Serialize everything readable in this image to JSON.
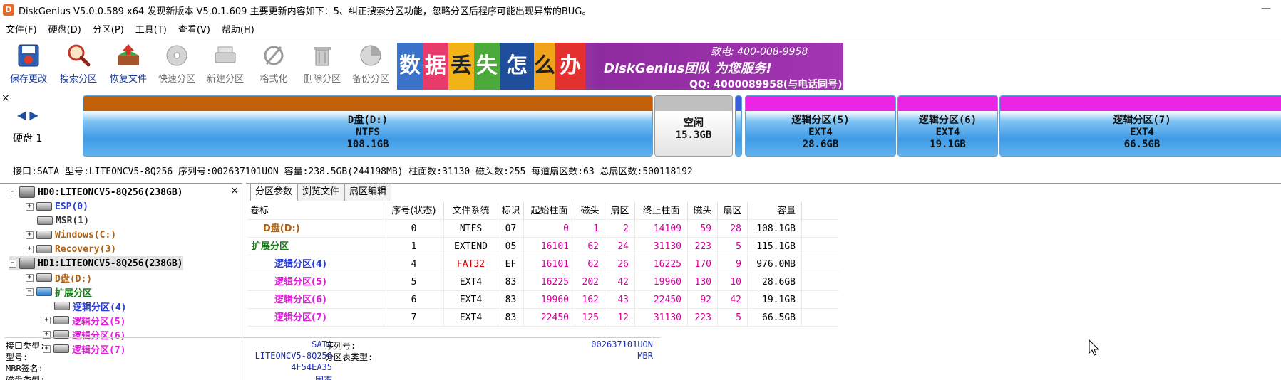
{
  "window": {
    "title": "DiskGenius V5.0.0.589 x64   发现新版本 V5.0.1.609 主要更新内容如下：5、纠正搜索分区功能，忽略分区后程序可能出现异常的BUG。",
    "app_icon": "D",
    "minimize_glyph": "—"
  },
  "menu": [
    "文件(F)",
    "硬盘(D)",
    "分区(P)",
    "工具(T)",
    "查看(V)",
    "帮助(H)"
  ],
  "toolbar": [
    {
      "label": "保存更改",
      "icon": "save-icon",
      "enabled": true
    },
    {
      "label": "搜索分区",
      "icon": "magnifier-icon",
      "enabled": true
    },
    {
      "label": "恢复文件",
      "icon": "recover-icon",
      "enabled": true
    },
    {
      "label": "快速分区",
      "icon": "quick-partition-icon",
      "enabled": false
    },
    {
      "label": "新建分区",
      "icon": "new-partition-icon",
      "enabled": false
    },
    {
      "label": "格式化",
      "icon": "format-icon",
      "enabled": false
    },
    {
      "label": "删除分区",
      "icon": "trash-icon",
      "enabled": false
    },
    {
      "label": "备份分区",
      "icon": "backup-icon",
      "enabled": false
    }
  ],
  "banner": {
    "tiles": [
      "数",
      "据",
      "丢",
      "失",
      "怎",
      "么",
      "办"
    ],
    "team_line": "DiskGenius团队 为您服务!",
    "phone_line": "致电: 400-008-9958",
    "qq_line": "QQ: 4000089958(与电话同号)",
    "colors": [
      "#3a73c9",
      "#e93a6c",
      "#f2b316",
      "#4caa3a",
      "#1f4f9c",
      "#f0a21a",
      "#e4312f"
    ]
  },
  "disk_bar": {
    "close_glyph": "×",
    "nav_glyphs": "◀ ▶",
    "disk_label": "硬盘 1",
    "partitions": [
      {
        "name": "D盘(D:)",
        "fs": "NTFS",
        "size": "108.1GB",
        "cap_color": "#c0600a"
      },
      {
        "name": "空闲",
        "fs": "",
        "size": "15.3GB",
        "cap_color": "#bfbfbf"
      },
      {
        "name": "逻辑分区(5)",
        "fs": "EXT4",
        "size": "28.6GB",
        "cap_color": "#ea25e4"
      },
      {
        "name": "逻辑分区(6)",
        "fs": "EXT4",
        "size": "19.1GB",
        "cap_color": "#ea25e4"
      },
      {
        "name": "逻辑分区(7)",
        "fs": "EXT4",
        "size": "66.5GB",
        "cap_color": "#ea25e4"
      }
    ],
    "info_line": "接口:SATA  型号:LITEONCV5-8Q256  序列号:002637101UON  容量:238.5GB(244198MB)  柱面数:31130  磁头数:255  每道扇区数:63  总扇区数:500118192"
  },
  "tree": {
    "close_glyph": "×",
    "items": [
      {
        "label": "HD0:LITEONCV5-8Q256(238GB)",
        "color": "#000000",
        "exp": "−",
        "kind": "disk"
      },
      {
        "label": "ESP(0)",
        "color": "#2a3fd8",
        "exp": "+",
        "kind": "part"
      },
      {
        "label": "MSR(1)",
        "color": "#333333",
        "exp": "",
        "kind": "part"
      },
      {
        "label": "Windows(C:)",
        "color": "#b06010",
        "exp": "+",
        "kind": "part"
      },
      {
        "label": "Recovery(3)",
        "color": "#b06010",
        "exp": "+",
        "kind": "part"
      },
      {
        "label": "HD1:LITEONCV5-8Q256(238GB)",
        "color": "#000000",
        "exp": "−",
        "kind": "disk"
      },
      {
        "label": "D盘(D:)",
        "color": "#b06010",
        "exp": "+",
        "kind": "part"
      },
      {
        "label": "扩展分区",
        "color": "#1a7a1a",
        "exp": "−",
        "kind": "ext"
      },
      {
        "label": "逻辑分区(4)",
        "color": "#2a3fd8",
        "exp": "",
        "kind": "part"
      },
      {
        "label": "逻辑分区(5)",
        "color": "#e020d8",
        "exp": "+",
        "kind": "part"
      },
      {
        "label": "逻辑分区(6)",
        "color": "#e020d8",
        "exp": "+",
        "kind": "part"
      },
      {
        "label": "逻辑分区(7)",
        "color": "#e020d8",
        "exp": "+",
        "kind": "part"
      }
    ]
  },
  "tabs": [
    "分区参数",
    "浏览文件",
    "扇区编辑"
  ],
  "table": {
    "headers": [
      "卷标",
      "序号(状态)",
      "文件系统",
      "标识",
      "起始柱面",
      "磁头",
      "扇区",
      "终止柱面",
      "磁头",
      "扇区",
      "容量"
    ],
    "rows": [
      {
        "name": "D盘(D:)",
        "color": "#b06010",
        "indent": 1,
        "cells": [
          "0",
          "NTFS",
          "07",
          "0",
          "1",
          "2",
          "14109",
          "59",
          "28",
          "108.1GB"
        ]
      },
      {
        "name": "扩展分区",
        "color": "#1a7a1a",
        "indent": 0,
        "cells": [
          "1",
          "EXTEND",
          "05",
          "16101",
          "62",
          "24",
          "31130",
          "223",
          "5",
          "115.1GB"
        ]
      },
      {
        "name": "逻辑分区(4)",
        "color": "#2a3fd8",
        "indent": 2,
        "fs_red": true,
        "cells": [
          "4",
          "FAT32",
          "EF",
          "16101",
          "62",
          "26",
          "16225",
          "170",
          "9",
          "976.0MB"
        ]
      },
      {
        "name": "逻辑分区(5)",
        "color": "#e020d8",
        "indent": 2,
        "cells": [
          "5",
          "EXT4",
          "83",
          "16225",
          "202",
          "42",
          "19960",
          "130",
          "10",
          "28.6GB"
        ]
      },
      {
        "name": "逻辑分区(6)",
        "color": "#e020d8",
        "indent": 2,
        "cells": [
          "6",
          "EXT4",
          "83",
          "19960",
          "162",
          "43",
          "22450",
          "92",
          "42",
          "19.1GB"
        ]
      },
      {
        "name": "逻辑分区(7)",
        "color": "#e020d8",
        "indent": 2,
        "cells": [
          "7",
          "EXT4",
          "83",
          "22450",
          "125",
          "12",
          "31130",
          "223",
          "5",
          "66.5GB"
        ]
      }
    ]
  },
  "details": {
    "left": [
      {
        "label": "接口类型:",
        "value": "SATA"
      },
      {
        "label": "型号:",
        "value": "LITEONCV5-8Q256"
      },
      {
        "label": "MBR签名:",
        "value": "4F54EA35"
      },
      {
        "label": "磁盘类型:",
        "value": "固态"
      }
    ],
    "right": [
      {
        "label": "序列号:",
        "value": "002637101UON"
      },
      {
        "label": "分区表类型:",
        "value": "MBR"
      }
    ]
  }
}
